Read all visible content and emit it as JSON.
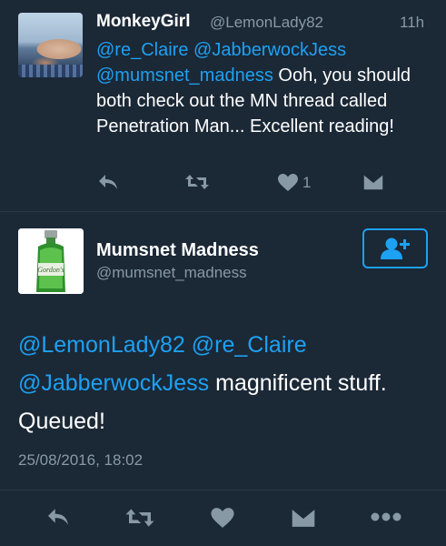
{
  "tweet1": {
    "name": "MonkeyGirl",
    "handle": "@LemonLady82",
    "time": "11h",
    "mentions": [
      "@re_Claire",
      "@JabberwockJess",
      "@mumsnet_madness"
    ],
    "text": "Ooh, you should both check out the MN thread called Penetration Man... Excellent reading!",
    "like_count": "1",
    "actions": [
      "reply-icon",
      "retweet-icon",
      "heart-icon",
      "dm-icon"
    ]
  },
  "tweet2": {
    "name": "Mumsnet Madness",
    "handle": "@mumsnet_madness",
    "mentions": [
      "@LemonLady82",
      "@re_Claire",
      "@JabberwockJess"
    ],
    "text": "magnificent stuff. Queued!",
    "date": "25/08/2016, 18:02",
    "avatar_label": "Gordon's",
    "actions": [
      "reply-icon",
      "retweet-icon",
      "heart-icon",
      "dm-icon",
      "more-icon"
    ]
  },
  "colors": {
    "background": "#1b2836",
    "accent": "#1da1f2",
    "muted": "#8899a6",
    "text": "#ffffff"
  }
}
